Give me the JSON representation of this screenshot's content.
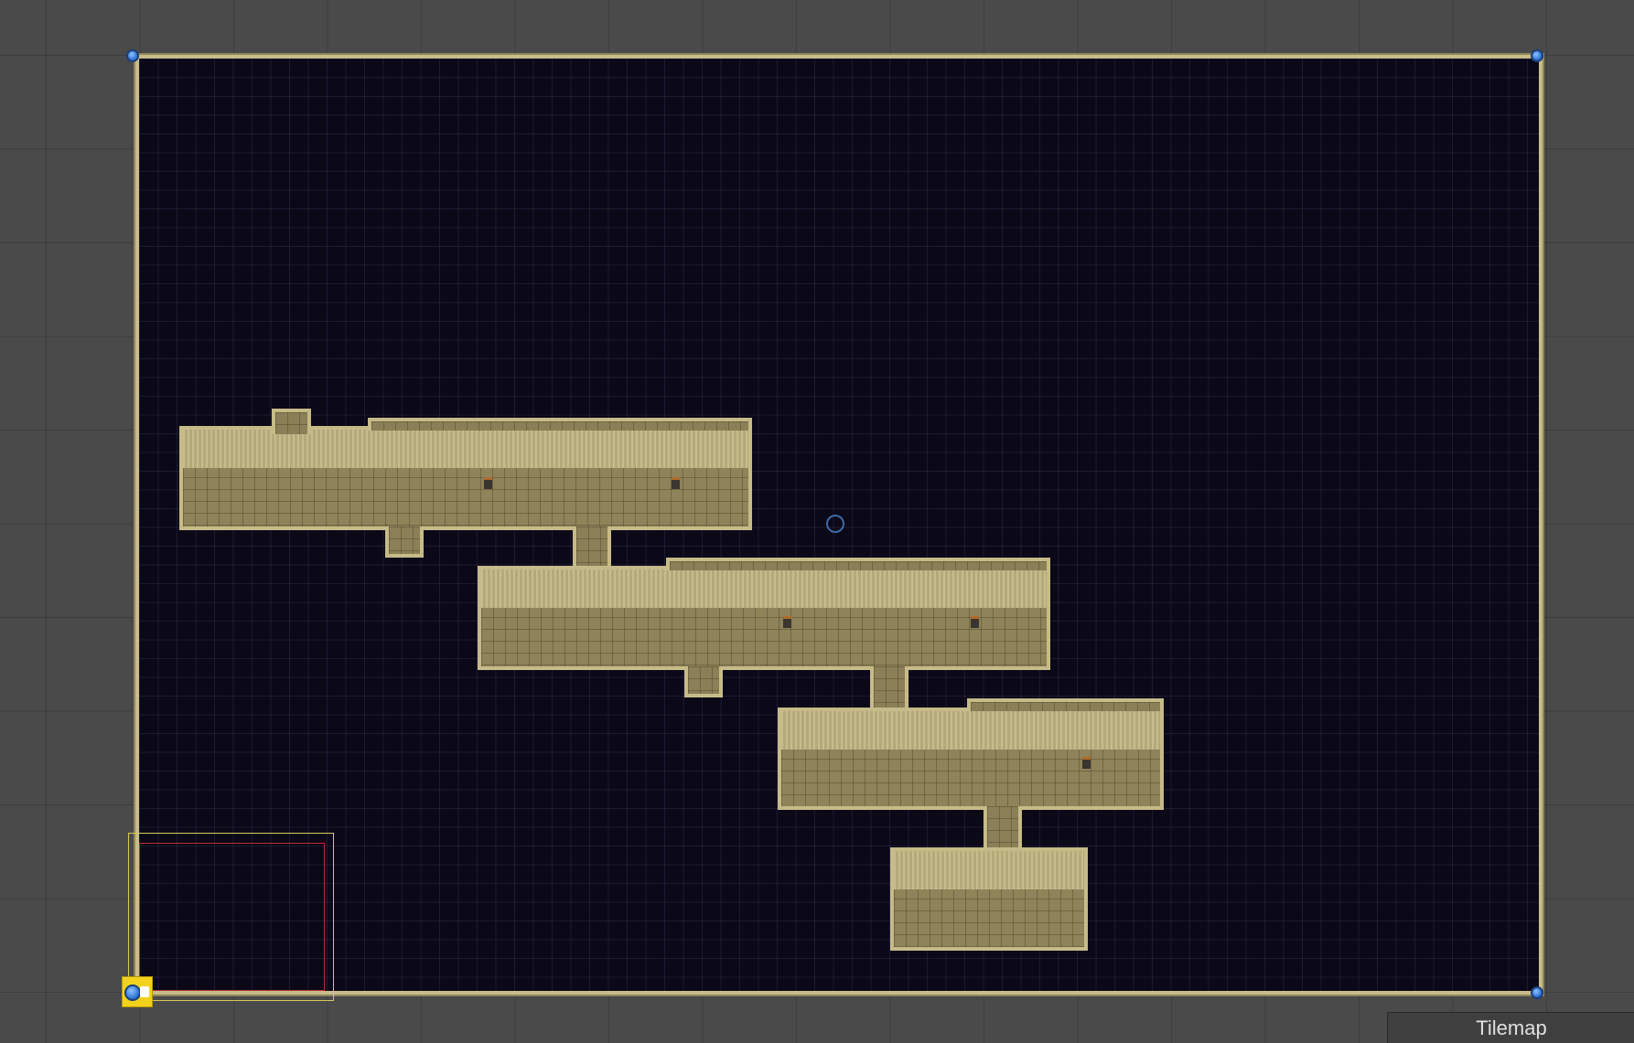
{
  "scene": {
    "object_label": "Tilemap",
    "colors": {
      "editor_background": "#4a4a4a",
      "map_background": "#0b0818",
      "floor": "#8e8359",
      "wall": "#b4a979",
      "border": "#c6bb88",
      "handle": "#2a6fd0",
      "camera_outer": "#d8c95a",
      "camera_inner": "#b53030",
      "gizmo": "#f2d21d"
    },
    "icons": [
      "corner-handle-icon",
      "pivot-center-icon",
      "camera-gizmo-icon",
      "torch-icon"
    ]
  }
}
